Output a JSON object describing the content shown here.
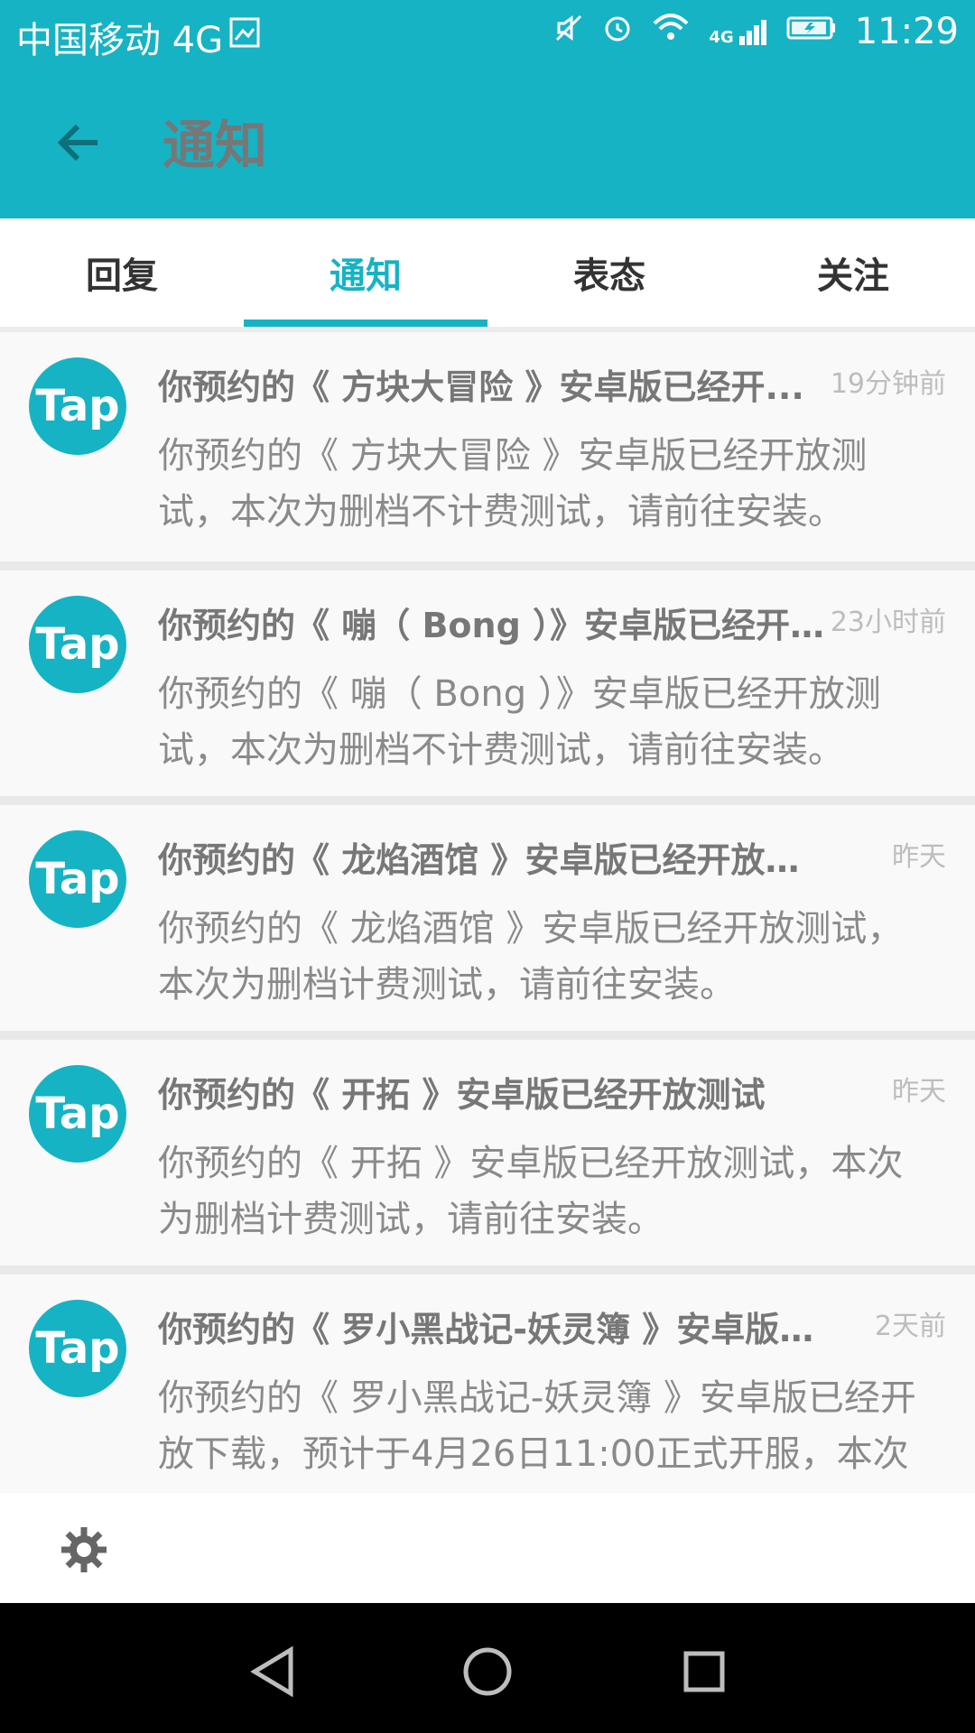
{
  "status": {
    "carrier": "中国移动 4G",
    "time": "11:29",
    "net": "4G"
  },
  "appbar": {
    "title": "通知"
  },
  "tabs": [
    {
      "label": "回复"
    },
    {
      "label": "通知"
    },
    {
      "label": "表态"
    },
    {
      "label": "关注"
    }
  ],
  "notifications": [
    {
      "avatar": "Tap",
      "title": "你预约的《 方块大冒险 》安卓版已经开...",
      "time": "19分钟前",
      "body": "你预约的《 方块大冒险 》安卓版已经开放测试，本次为删档不计费测试，请前往安装。"
    },
    {
      "avatar": "Tap",
      "title": "你预约的《 嘣（ Bong ）》安卓版已经开...",
      "time": "23小时前",
      "body": "你预约的《 嘣（ Bong ）》安卓版已经开放测试，本次为删档不计费测试，请前往安装。"
    },
    {
      "avatar": "Tap",
      "title": "你预约的《 龙焰酒馆 》安卓版已经开放测试",
      "time": "昨天",
      "body": "你预约的《 龙焰酒馆 》安卓版已经开放测试，本次为删档计费测试，请前往安装。"
    },
    {
      "avatar": "Tap",
      "title": "你预约的《 开拓 》安卓版已经开放测试",
      "time": "昨天",
      "body": "你预约的《 开拓 》安卓版已经开放测试，本次为删档计费测试，请前往安装。"
    },
    {
      "avatar": "Tap",
      "title": "你预约的《 罗小黑战记-妖灵簿 》安卓版已...",
      "time": "2天前",
      "body": "你预约的《 罗小黑战记-妖灵簿 》安卓版已经开放下载，预计于4月26日11:00正式开服，本次"
    }
  ],
  "colors": {
    "primary": "#16b3c4",
    "background": "#f3f3f3",
    "text_primary": "#777777",
    "text_secondary": "#8a8a8a",
    "time": "#bdbdbd"
  },
  "icons": {
    "back": "arrow-left-icon",
    "settings": "gear-icon",
    "nav_back": "triangle-left-icon",
    "nav_home": "circle-home-icon",
    "nav_recent": "square-recent-icon"
  }
}
